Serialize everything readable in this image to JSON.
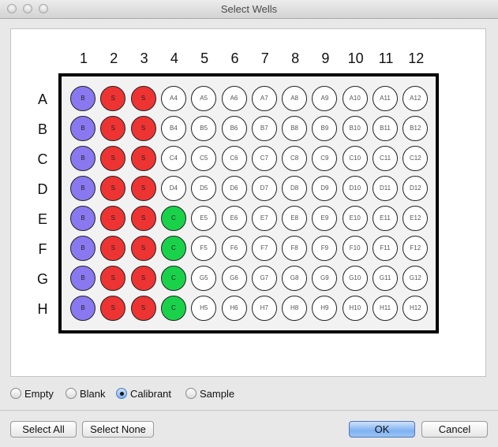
{
  "window": {
    "title": "Select Wells",
    "controls": [
      "close-icon",
      "minimize-icon",
      "zoom-icon"
    ]
  },
  "plate": {
    "columns": [
      "1",
      "2",
      "3",
      "4",
      "5",
      "6",
      "7",
      "8",
      "9",
      "10",
      "11",
      "12"
    ],
    "rows": [
      "A",
      "B",
      "C",
      "D",
      "E",
      "F",
      "G",
      "H"
    ],
    "wells": [
      [
        "B",
        "S",
        "S",
        "A4",
        "A5",
        "A6",
        "A7",
        "A8",
        "A9",
        "A10",
        "A11",
        "A12"
      ],
      [
        "B",
        "S",
        "S",
        "B4",
        "B5",
        "B6",
        "B7",
        "B8",
        "B9",
        "B10",
        "B11",
        "B12"
      ],
      [
        "B",
        "S",
        "S",
        "C4",
        "C5",
        "C6",
        "C7",
        "C8",
        "C9",
        "C10",
        "C11",
        "C12"
      ],
      [
        "B",
        "S",
        "S",
        "D4",
        "D5",
        "D6",
        "D7",
        "D8",
        "D9",
        "D10",
        "D11",
        "D12"
      ],
      [
        "B",
        "S",
        "S",
        "C",
        "E5",
        "E6",
        "E7",
        "E8",
        "E9",
        "E10",
        "E11",
        "E12"
      ],
      [
        "B",
        "S",
        "S",
        "C",
        "F5",
        "F6",
        "F7",
        "F8",
        "F9",
        "F10",
        "F11",
        "F12"
      ],
      [
        "B",
        "S",
        "S",
        "C",
        "G5",
        "G6",
        "G7",
        "G8",
        "G9",
        "G10",
        "G11",
        "G12"
      ],
      [
        "B",
        "S",
        "S",
        "C",
        "H5",
        "H6",
        "H7",
        "H8",
        "H9",
        "H10",
        "H11",
        "H12"
      ]
    ],
    "colors": {
      "blank": "#8a78f0",
      "sample": "#ee3333",
      "calibrant": "#19d24a",
      "empty": "#ffffff"
    }
  },
  "radio_options": [
    {
      "label": "Empty",
      "selected": false
    },
    {
      "label": "Blank",
      "selected": false
    },
    {
      "label": "Calibrant",
      "selected": true
    },
    {
      "label": "Sample",
      "selected": false
    }
  ],
  "buttons": {
    "select_all": "Select All",
    "select_none": "Select None",
    "ok": "OK",
    "cancel": "Cancel"
  }
}
